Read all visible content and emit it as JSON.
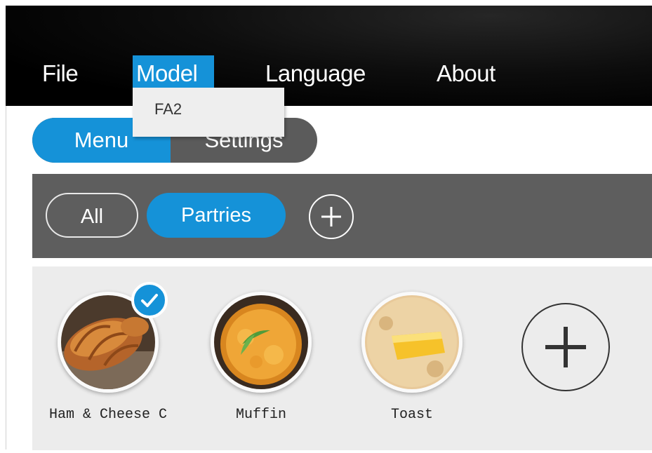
{
  "menubar": {
    "items": [
      {
        "label": "File"
      },
      {
        "label": "Model"
      },
      {
        "label": "Language"
      },
      {
        "label": "About"
      }
    ],
    "dropdown": {
      "items": [
        {
          "label": "FA2"
        }
      ]
    }
  },
  "tabs": {
    "menu_label": "Menu",
    "settings_label": "Settings"
  },
  "categories": {
    "items": [
      {
        "label": "All"
      },
      {
        "label": "Partries"
      }
    ]
  },
  "recipes": [
    {
      "name": "Ham & Cheese C",
      "checked": true
    },
    {
      "name": "Muffin",
      "checked": false
    },
    {
      "name": "Toast",
      "checked": false
    }
  ],
  "colors": {
    "accent": "#1592d8",
    "bar": "#5e5e5e",
    "panel": "#ececec"
  }
}
